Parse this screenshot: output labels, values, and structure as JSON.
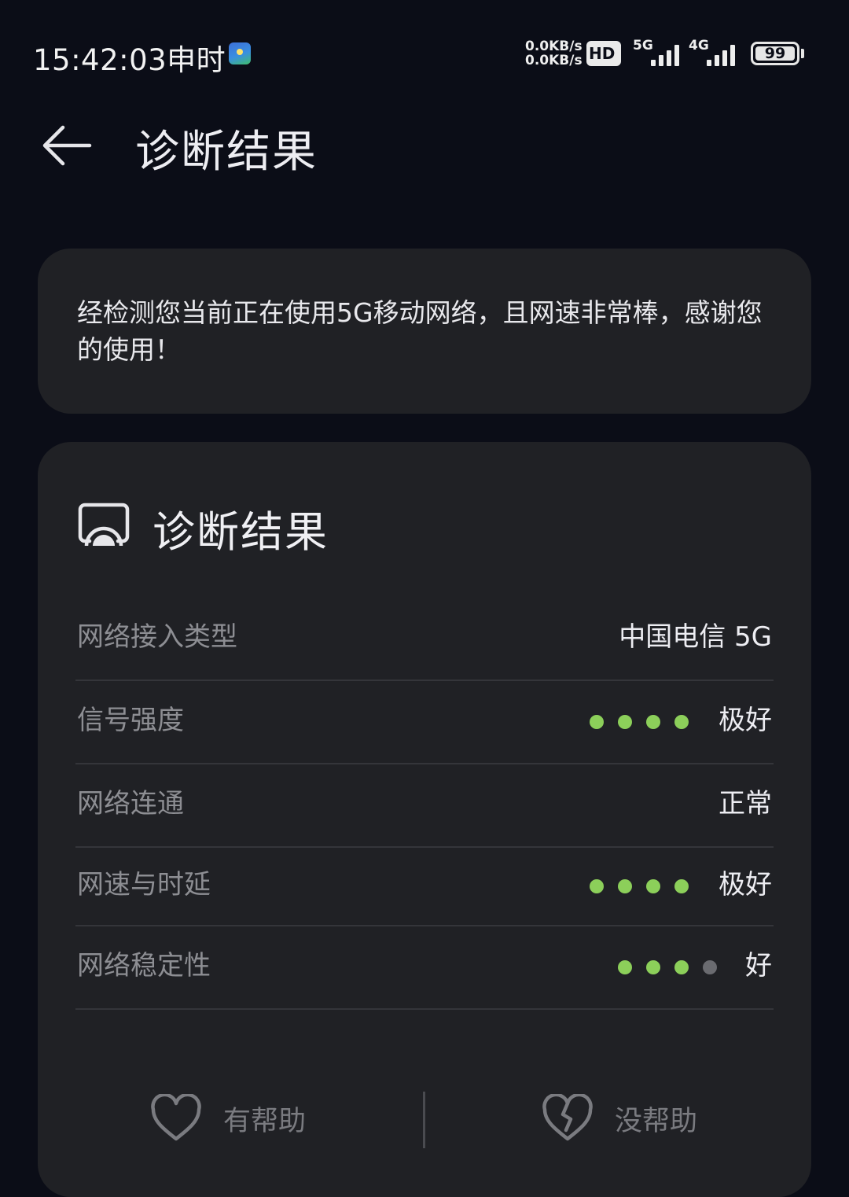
{
  "status_bar": {
    "time": "15:42:03申时",
    "speed_up": "0.0KB/s",
    "speed_down": "0.0KB/s",
    "hd_label": "HD",
    "net1": "5G",
    "net2": "4G",
    "battery": "99"
  },
  "header": {
    "title": "诊断结果"
  },
  "summary": {
    "text": "经检测您当前正在使用5G移动网络，且网速非常棒，感谢您的使用！"
  },
  "result": {
    "title": "诊断结果",
    "rows": [
      {
        "label": "网络接入类型",
        "value": "中国电信 5G"
      },
      {
        "label": "信号强度",
        "value": "极好",
        "rating": 4,
        "max": 4
      },
      {
        "label": "网络连通",
        "value": "正常"
      },
      {
        "label": "网速与时延",
        "value": "极好",
        "rating": 4,
        "max": 4
      },
      {
        "label": "网络稳定性",
        "value": "好",
        "rating": 3,
        "max": 4
      }
    ]
  },
  "feedback": {
    "helpful": "有帮助",
    "not_helpful": "没帮助"
  },
  "colors": {
    "background": "#0b0d17",
    "card": "#202125",
    "dot_on": "#8ccf5a",
    "dot_off": "#6a6b70"
  }
}
